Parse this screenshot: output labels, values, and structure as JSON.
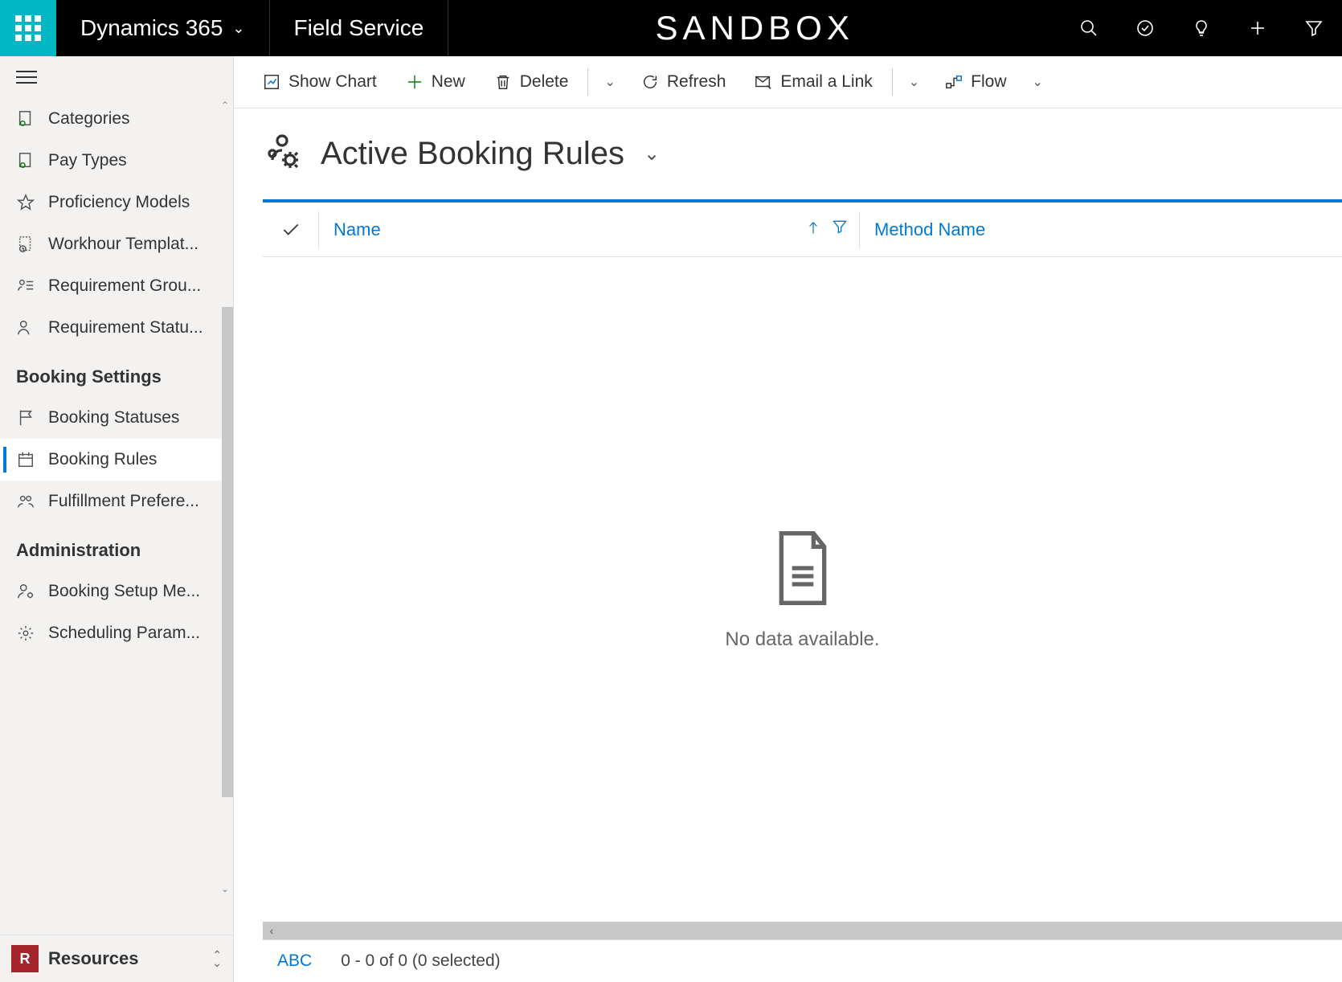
{
  "header": {
    "app_name": "Dynamics 365",
    "module": "Field Service",
    "environment": "SANDBOX"
  },
  "sidebar": {
    "items": [
      {
        "label": "Categories",
        "icon": "document-person-icon"
      },
      {
        "label": "Pay Types",
        "icon": "document-person-icon"
      },
      {
        "label": "Proficiency Models",
        "icon": "star-icon"
      },
      {
        "label": "Workhour Templat...",
        "icon": "document-clock-icon"
      },
      {
        "label": "Requirement Grou...",
        "icon": "person-list-icon"
      },
      {
        "label": "Requirement Statu...",
        "icon": "person-icon"
      }
    ],
    "section_booking": "Booking Settings",
    "booking_items": [
      {
        "label": "Booking Statuses",
        "icon": "flag-icon"
      },
      {
        "label": "Booking Rules",
        "icon": "calendar-icon",
        "active": true
      },
      {
        "label": "Fulfillment Prefere...",
        "icon": "people-icon"
      }
    ],
    "section_admin": "Administration",
    "admin_items": [
      {
        "label": "Booking Setup Me...",
        "icon": "person-gear-icon"
      },
      {
        "label": "Scheduling Param...",
        "icon": "gear-icon"
      }
    ],
    "area": {
      "badge": "R",
      "label": "Resources"
    }
  },
  "commands": {
    "show_chart": "Show Chart",
    "new": "New",
    "delete": "Delete",
    "refresh": "Refresh",
    "email": "Email a Link",
    "flow": "Flow"
  },
  "view": {
    "title": "Active Booking Rules"
  },
  "grid": {
    "columns": {
      "name": "Name",
      "method_name": "Method Name"
    },
    "empty": "No data available.",
    "abc": "ABC",
    "footer_count": "0 - 0 of 0 (0 selected)"
  }
}
